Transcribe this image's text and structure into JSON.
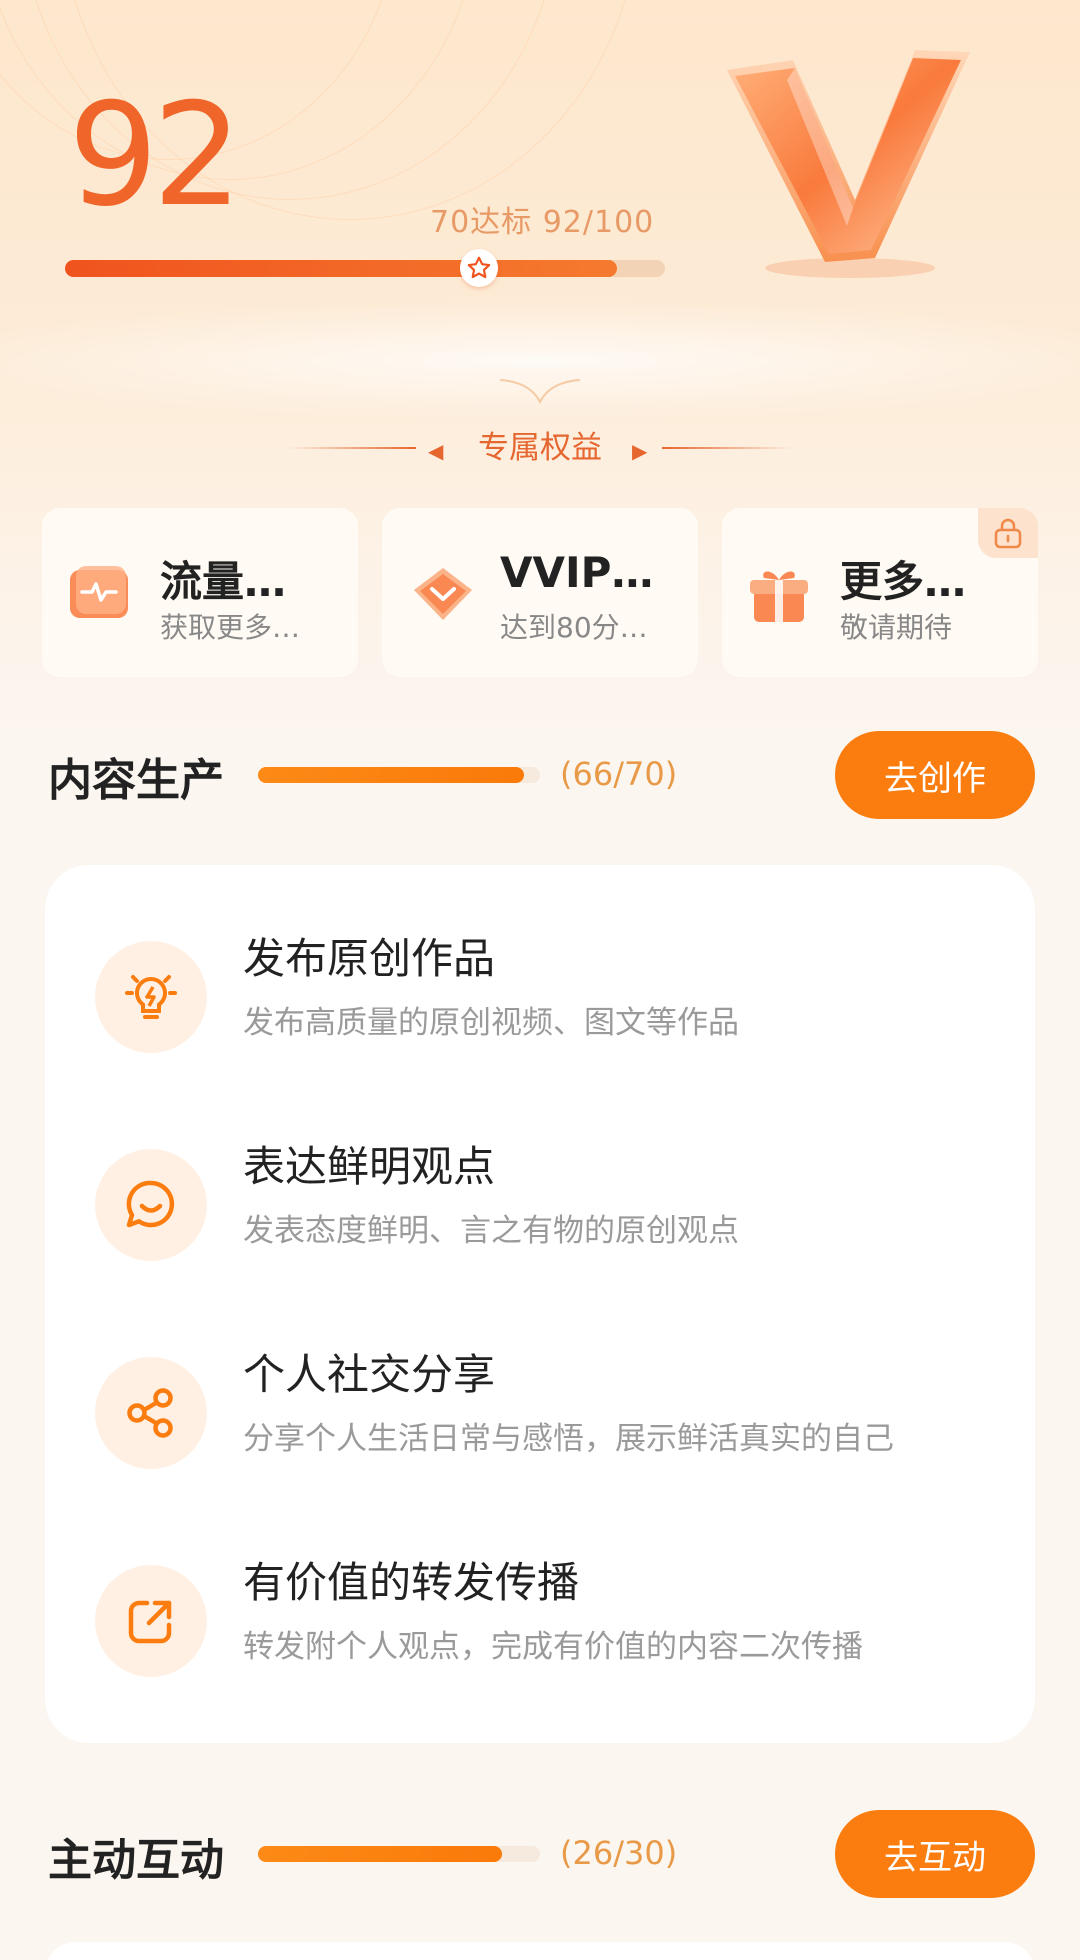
{
  "score": {
    "value": "92",
    "standard_text": "70达标  92/100",
    "progress": 0.92,
    "standard_mark": 0.7
  },
  "benefits_section": {
    "title": "专属权益"
  },
  "benefits": [
    {
      "title": "流量…",
      "subtitle": "获取更多…",
      "icon": "traffic-icon"
    },
    {
      "title": "VVIP…",
      "subtitle": "达到80分…",
      "icon": "diamond-icon"
    },
    {
      "title": "更多…",
      "subtitle": "敬请期待",
      "icon": "gift-icon",
      "locked": true
    }
  ],
  "content_production": {
    "title": "内容生产",
    "count": "(66/70)",
    "progress": 0.943,
    "button": "去创作",
    "items": [
      {
        "title": "发布原创作品",
        "desc": "发布高质量的原创视频、图文等作品",
        "icon": "lightbulb-icon"
      },
      {
        "title": "表达鲜明观点",
        "desc": "发表态度鲜明、言之有物的原创观点",
        "icon": "chat-bubble-icon"
      },
      {
        "title": "个人社交分享",
        "desc": "分享个人生活日常与感悟，展示鲜活真实的自己",
        "icon": "share-icon"
      },
      {
        "title": "有价值的转发传播",
        "desc": "转发附个人观点，完成有价值的内容二次传播",
        "icon": "forward-icon"
      }
    ]
  },
  "active_interaction": {
    "title": "主动互动",
    "count": "(26/30)",
    "progress": 0.867,
    "button": "去互动"
  },
  "colors": {
    "accent": "#f0662a",
    "button": "#fb7d10",
    "progress_track": "#f2d3b5"
  }
}
